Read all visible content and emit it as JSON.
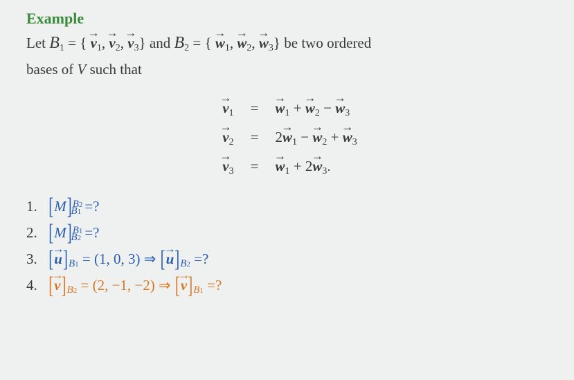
{
  "title": "Example",
  "intro": {
    "let": "Let",
    "B1": "B",
    "B1sub": "1",
    "eq": " = ",
    "lbrace": "{",
    "rbrace": "}",
    "v": "v",
    "w": "w",
    "s1": "1",
    "s2": "2",
    "s3": "3",
    "and": " and ",
    "B2": "B",
    "B2sub": "2",
    "tail1": " be two ordered",
    "tail2": "bases of ",
    "V": "V",
    "tail3": " such that"
  },
  "equations": {
    "l1": "v",
    "l1s": "1",
    "r1a": "w",
    "r1as": "1",
    "r1b": "w",
    "r1bs": "2",
    "r1c": "w",
    "r1cs": "3",
    "l2": "v",
    "l2s": "2",
    "r2pre": "2",
    "r2a": "w",
    "r2as": "1",
    "r2b": "w",
    "r2bs": "2",
    "r2c": "w",
    "r2cs": "3",
    "l3": "v",
    "l3s": "3",
    "r3a": "w",
    "r3as": "1",
    "r3mid": " + 2",
    "r3b": "w",
    "r3bs": "3",
    "r3dot": ".",
    "eqsym": "=",
    "plus": " + ",
    "minus": " − "
  },
  "q": {
    "n1": "1.",
    "n2": "2.",
    "n3": "3.",
    "n4": "4.",
    "M": "M",
    "lbr": "[",
    "rbr": "]",
    "qmark": " =?",
    "B1": "B",
    "B1s": "1",
    "B2": "B",
    "B2s": "2",
    "u": "u",
    "v": "v",
    "tup3": " = (1, 0, 3) ",
    "tup4": " = (2, −1, −2) ",
    "imp": "⇒ "
  }
}
